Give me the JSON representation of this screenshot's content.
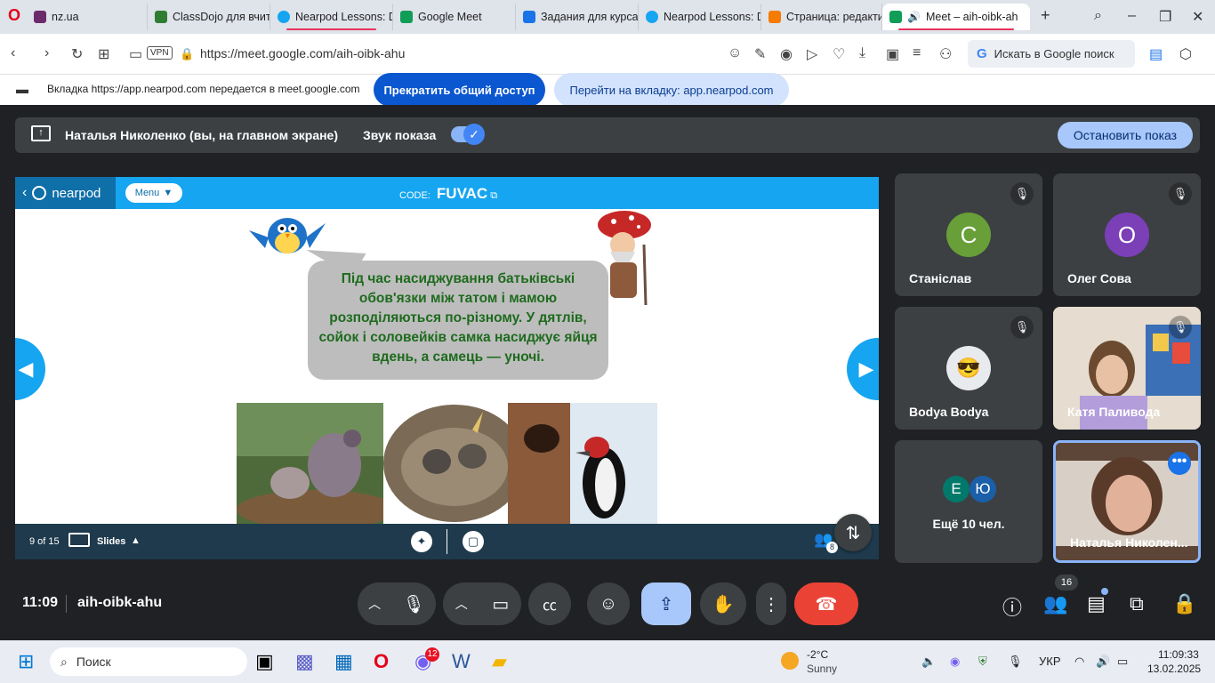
{
  "browser": {
    "tabs": [
      {
        "label": "nz.ua",
        "color": "#6b2b6b"
      },
      {
        "label": "ClassDojo для вчите",
        "color": "#2e7d32"
      },
      {
        "label": "Nearpod Lessons: D",
        "color": "#16a5f0"
      },
      {
        "label": "Google Meet",
        "color": "#0f9d58"
      },
      {
        "label": "Задания для курса",
        "color": "#1a73e8"
      },
      {
        "label": "Nearpod Lessons: D",
        "color": "#16a5f0"
      },
      {
        "label": "Страница: редактир",
        "color": "#f57c00"
      },
      {
        "label": "Meet – aih-oibk-ah",
        "color": "#0f9d58"
      }
    ],
    "url": "https://meet.google.com/aih-oibk-ahu",
    "vpn_label": "VPN",
    "search_placeholder": "Искать в Google поиск"
  },
  "share_banner": {
    "message": "Вкладка https://app.nearpod.com передается в meet.google.com",
    "stop_label": "Прекратить общий доступ",
    "goto_label": "Перейти на вкладку: app.nearpod.com"
  },
  "presenting": {
    "presenter": "Наталья Николенко (вы, на главном экране)",
    "sound_label": "Звук показа",
    "stop_label": "Остановить показ"
  },
  "nearpod": {
    "logo": "nearpod",
    "menu_label": "Menu",
    "code_label": "CODE:",
    "code_value": "FUVAC",
    "slide_text": "Під час насиджування батьківські обов'язки між татом і мамою розподіляються по-різному. У дятлів, сойок і соловейків самка насиджує яйця вдень, а самець — уночі.",
    "slide_counter": "9 of 15",
    "slides_label": "Slides",
    "students_count": "8"
  },
  "participants": [
    {
      "name": "Станіслав",
      "initial": "С",
      "color": "#689f38",
      "muted": true
    },
    {
      "name": "Олег Сова",
      "initial": "О",
      "color": "#7b3fb8",
      "muted": true
    },
    {
      "name": "Bodya Bodya",
      "initial": "",
      "color": "#e8eaed",
      "muted": true
    },
    {
      "name": "Катя Паливода",
      "initial": "",
      "color": "#c9a38b",
      "muted": true
    },
    {
      "name": "Ещё 10 чел.",
      "initials": [
        "Е",
        "Ю"
      ],
      "color": "#00796b"
    },
    {
      "name": "Наталья Николен...",
      "initial": "",
      "color": "#8d6e63",
      "muted": false
    }
  ],
  "controls": {
    "time": "11:09",
    "meeting_code": "aih-oibk-ahu",
    "people_badge": "16"
  },
  "taskbar": {
    "search_label": "Поиск",
    "weather_temp": "-2°C",
    "weather_desc": "Sunny",
    "lang": "УКР",
    "clock_time": "11:09:33",
    "clock_date": "13.02.2025",
    "viber_badge": "12"
  }
}
